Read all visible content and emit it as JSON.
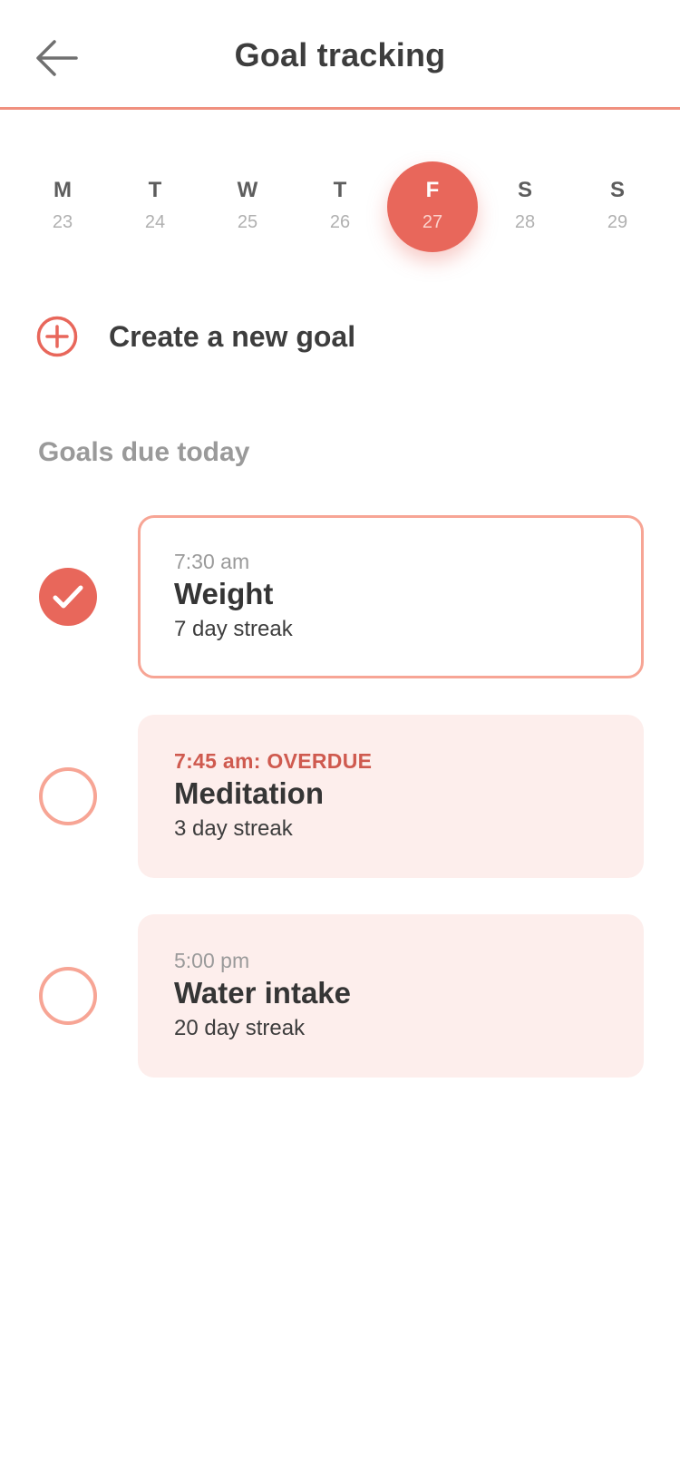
{
  "header": {
    "title": "Goal tracking",
    "back_icon": "arrow-left-icon"
  },
  "week": [
    {
      "letter": "M",
      "date": "23"
    },
    {
      "letter": "T",
      "date": "24"
    },
    {
      "letter": "W",
      "date": "25"
    },
    {
      "letter": "T",
      "date": "26"
    },
    {
      "letter": "F",
      "date": "27",
      "selected": true
    },
    {
      "letter": "S",
      "date": "28"
    },
    {
      "letter": "S",
      "date": "29"
    }
  ],
  "create": {
    "label": "Create a new goal",
    "icon": "plus-circle-icon"
  },
  "section_title": "Goals due today",
  "goals": [
    {
      "time": "7:30 am",
      "name": "Weight",
      "streak": "7 day streak",
      "completed": true,
      "overdue": false
    },
    {
      "time": "7:45 am: OVERDUE",
      "name": "Meditation",
      "streak": "3 day streak",
      "completed": false,
      "overdue": true
    },
    {
      "time": "5:00 pm",
      "name": "Water intake",
      "streak": "20 day streak",
      "completed": false,
      "overdue": false
    }
  ],
  "colors": {
    "accent": "#e8675b",
    "accent_light": "#f7a595",
    "card_tint": "#fdeeec",
    "overdue_text": "#cf5a4f",
    "header_rule": "#f0907f"
  }
}
